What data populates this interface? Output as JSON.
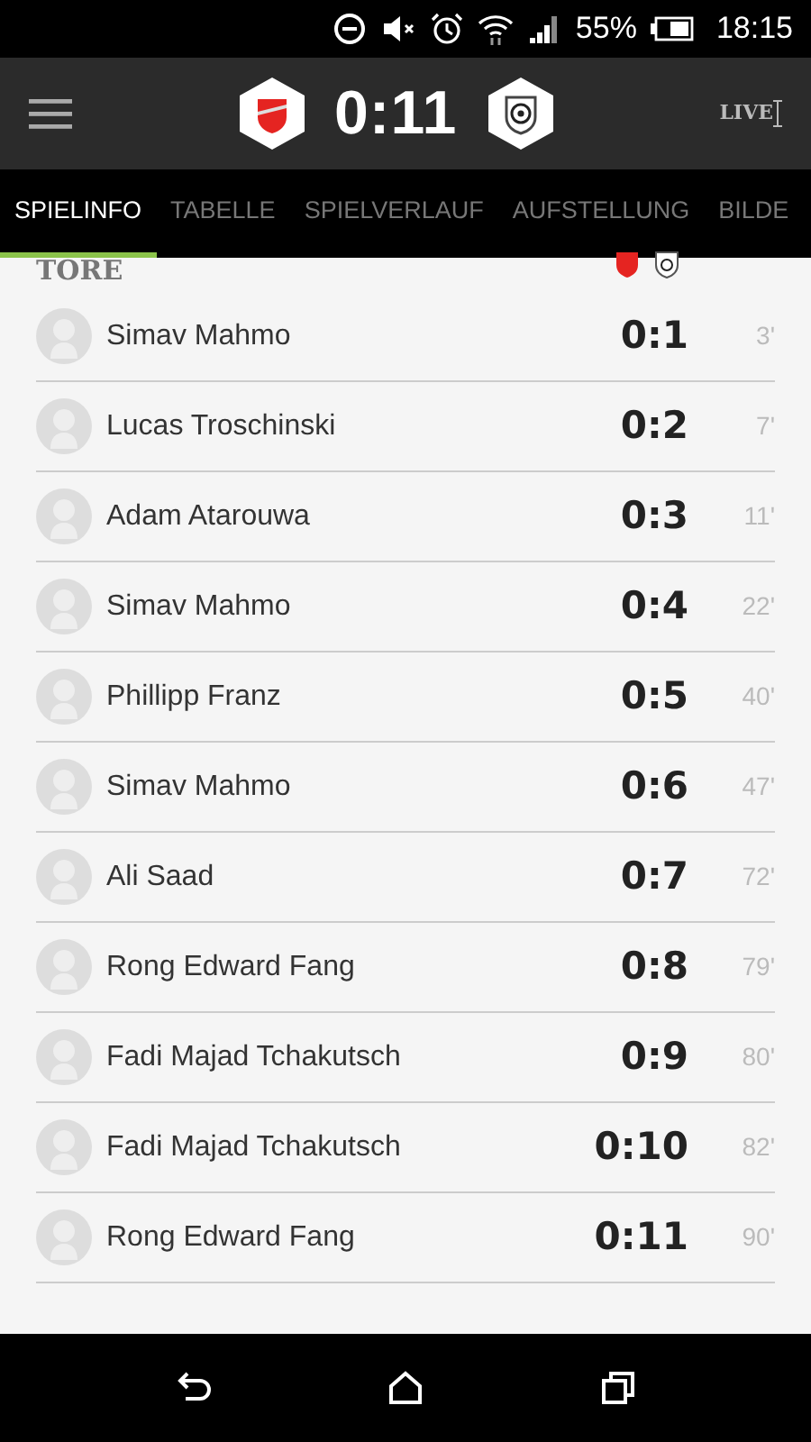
{
  "status_bar": {
    "battery": "55%",
    "time": "18:15"
  },
  "header": {
    "score": "0:11",
    "live_label": "LIVE"
  },
  "tabs": [
    {
      "label": "SPIELINFO",
      "selected": true
    },
    {
      "label": "TABELLE",
      "selected": false
    },
    {
      "label": "SPIELVERLAUF",
      "selected": false
    },
    {
      "label": "AUFSTELLUNG",
      "selected": false
    },
    {
      "label": "BILDE",
      "selected": false
    }
  ],
  "goals_section": {
    "title": "TORE",
    "goals": [
      {
        "player": "Simav Mahmo",
        "score": "0:1",
        "minute": "3'"
      },
      {
        "player": "Lucas Troschinski",
        "score": "0:2",
        "minute": "7'"
      },
      {
        "player": "Adam Atarouwa",
        "score": "0:3",
        "minute": "11'"
      },
      {
        "player": "Simav Mahmo",
        "score": "0:4",
        "minute": "22'"
      },
      {
        "player": "Phillipp Franz",
        "score": "0:5",
        "minute": "40'"
      },
      {
        "player": "Simav Mahmo",
        "score": "0:6",
        "minute": "47'"
      },
      {
        "player": "Ali Saad",
        "score": "0:7",
        "minute": "72'"
      },
      {
        "player": "Rong Edward Fang",
        "score": "0:8",
        "minute": "79'"
      },
      {
        "player": "Fadi Majad Tchakutsch",
        "score": "0:9",
        "minute": "80'"
      },
      {
        "player": "Fadi Majad Tchakutsch",
        "score": "0:10",
        "minute": "82'"
      },
      {
        "player": "Rong Edward Fang",
        "score": "0:11",
        "minute": "90'"
      }
    ]
  }
}
